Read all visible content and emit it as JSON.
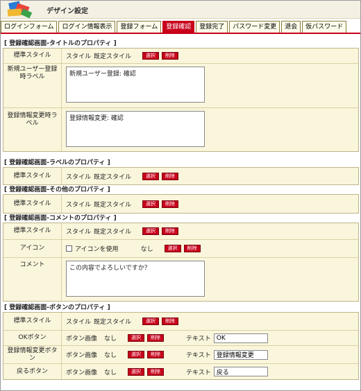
{
  "header": {
    "title": "デザイン設定"
  },
  "tabs": [
    {
      "label": "ログインフォーム"
    },
    {
      "label": "ログイン情報表示"
    },
    {
      "label": "登録フォーム"
    },
    {
      "label": "登録確認"
    },
    {
      "label": "登録完了"
    },
    {
      "label": "パスワード変更"
    },
    {
      "label": "退会"
    },
    {
      "label": "仮パスワード"
    }
  ],
  "common": {
    "style_word": "スタイル",
    "default_style": "既定スタイル",
    "select": "選択",
    "delete": "削除",
    "none": "なし",
    "button_image": "ボタン画像",
    "text_label": "テキスト"
  },
  "title_props": {
    "heading": "[ 登録確認画面-タイトルのプロパティ ]",
    "std_style": "標準スタイル",
    "new_user_label": "新規ユーザー登録時ラベル",
    "new_user_value": "新規ユーザー登録: 確認",
    "change_label": "登録情報変更時ラベル",
    "change_value": "登録情報変更: 確認"
  },
  "label_props": {
    "heading": "[ 登録確認画面-ラベルのプロパティ ]",
    "std_style": "標準スタイル"
  },
  "other_props": {
    "heading": "[ 登録確認画面-その他のプロパティ ]",
    "std_style": "標準スタイル"
  },
  "comment_props": {
    "heading": "[ 登録確認画面-コメントのプロパティ ]",
    "std_style": "標準スタイル",
    "icon_label": "アイコン",
    "use_icon": "アイコンを使用",
    "comment_label": "コメント",
    "comment_value": "この内容でよろしいですか？"
  },
  "button_props": {
    "heading": "[ 登録確認画面-ボタンのプロパティ ]",
    "std_style": "標準スタイル",
    "ok_label": "OKボタン",
    "ok_text": "OK",
    "change_label": "登録情報変更ボタン",
    "change_text": "登録情報変更",
    "back_label": "戻るボタン",
    "back_text": "戻る"
  }
}
